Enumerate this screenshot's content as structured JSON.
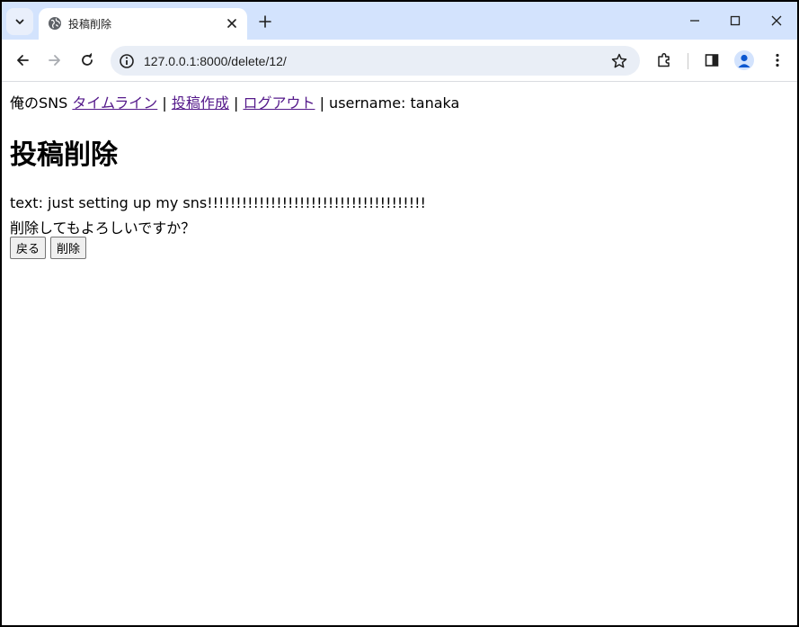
{
  "browser": {
    "tab_title": "投稿削除",
    "url": "127.0.0.1:8000/delete/12/"
  },
  "nav": {
    "brand": "俺のSNS",
    "links": [
      {
        "label": "タイムライン"
      },
      {
        "label": "投稿作成"
      },
      {
        "label": "ログアウト"
      }
    ],
    "separator": "|",
    "username_label": "username: tanaka"
  },
  "page": {
    "title": "投稿削除",
    "post_text": "text: just setting up my sns!!!!!!!!!!!!!!!!!!!!!!!!!!!!!!!!!!!!!!",
    "confirm_message": "削除してもよろしいですか？",
    "back_button": "戻る",
    "delete_button": "削除"
  },
  "colors": {
    "tabstrip": "#d3e3fd",
    "omnibox": "#e9eef6",
    "visited_link": "#551a8b"
  }
}
